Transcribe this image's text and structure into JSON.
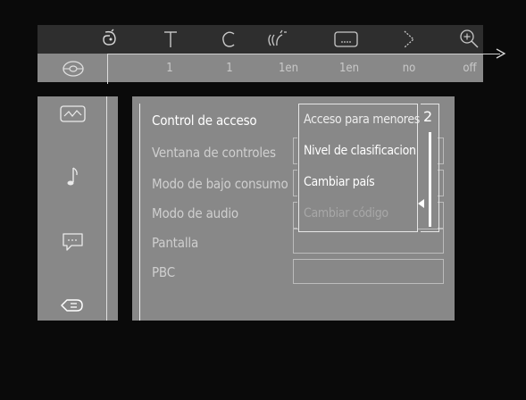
{
  "header": {
    "icons": [
      {
        "name": "subtitle-person-icon"
      },
      {
        "name": "title-icon"
      },
      {
        "name": "chapter-icon"
      },
      {
        "name": "audio-language-icon"
      },
      {
        "name": "subtitle-icon"
      },
      {
        "name": "angle-icon"
      },
      {
        "name": "zoom-icon"
      }
    ],
    "values": [
      "1",
      "1",
      "1en",
      "1en",
      "no",
      "off"
    ]
  },
  "sidebar": {
    "items": [
      {
        "name": "picture-settings-icon"
      },
      {
        "name": "sound-settings-icon"
      },
      {
        "name": "language-settings-icon"
      },
      {
        "name": "features-icon"
      }
    ]
  },
  "menu": {
    "items": [
      {
        "label": "Control de acceso"
      },
      {
        "label": "Ventana de controles"
      },
      {
        "label": "Modo de bajo consumo"
      },
      {
        "label": "Modo de audio"
      },
      {
        "label": "Pantalla"
      },
      {
        "label": "PBC"
      }
    ]
  },
  "submenu": {
    "items": [
      {
        "label": "Acceso para menores"
      },
      {
        "label": "Nivel de clasificacion"
      },
      {
        "label": "Cambiar país"
      },
      {
        "label": "Cambiar código"
      }
    ],
    "level_value": "2"
  }
}
